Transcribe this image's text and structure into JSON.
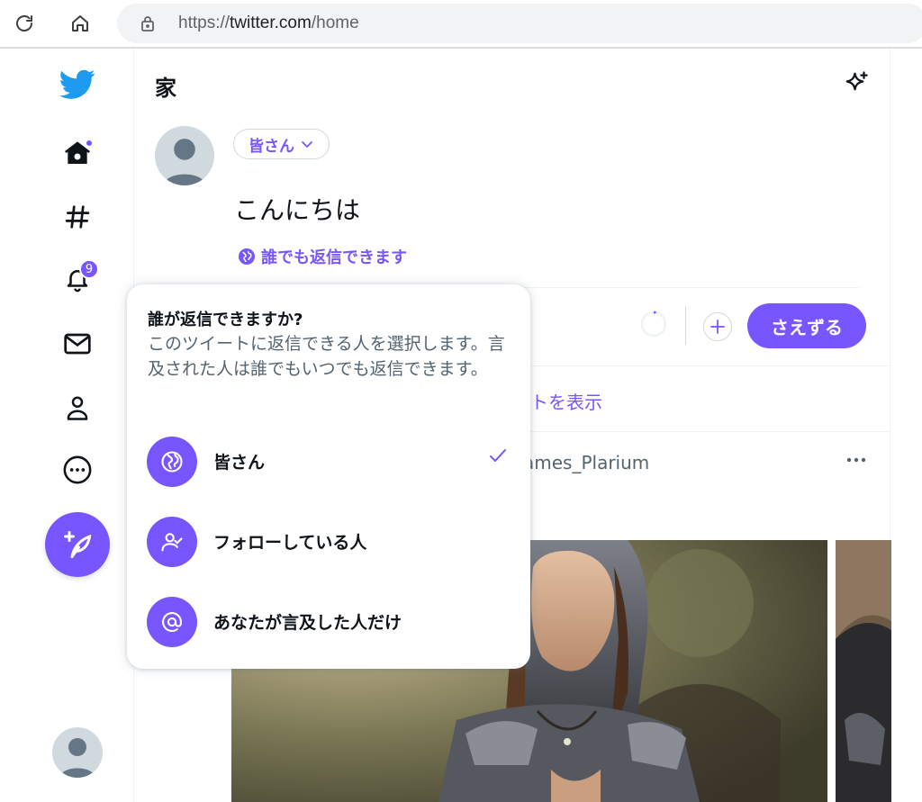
{
  "browser": {
    "url_scheme": "https://",
    "url_host": "twitter.com",
    "url_path": "/home"
  },
  "nav": {
    "notifications_badge": "9"
  },
  "header": {
    "title": "家"
  },
  "composer": {
    "audience_label": "皆さん",
    "text": "こんにちは",
    "reply_setting_label": "誰でも返信できます",
    "tweet_button": "さえずる"
  },
  "timeline": {
    "show_new_text": "トを表示",
    "tweet_author_fragment": "ames_Plarium"
  },
  "reply_popover": {
    "title": "誰が返信できますか?",
    "description": "このツイートに返信できる人を選択します。言及された人は誰でもいつでも返信できます。",
    "options": [
      {
        "label": "皆さん",
        "icon": "globe-icon",
        "selected": true
      },
      {
        "label": "フォローしている人",
        "icon": "person-check-icon",
        "selected": false
      },
      {
        "label": "あなたが言及した人だけ",
        "icon": "at-icon",
        "selected": false
      }
    ]
  },
  "colors": {
    "accent": "#7856ff",
    "text": "#0f1419",
    "muted": "#536471",
    "border": "#cfd9de"
  }
}
